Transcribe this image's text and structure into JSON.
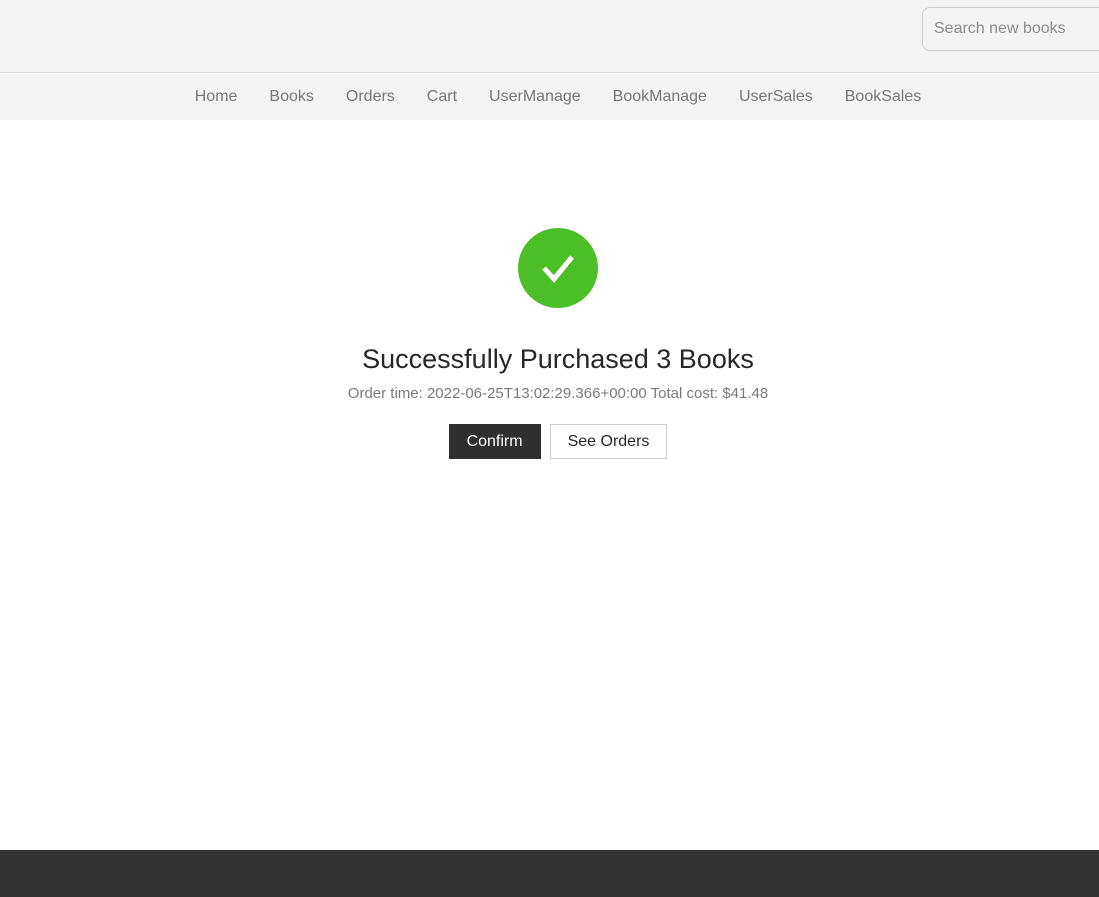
{
  "header": {
    "search": {
      "placeholder": "Search new books",
      "value": ""
    }
  },
  "nav": {
    "items": [
      {
        "label": "Home"
      },
      {
        "label": "Books"
      },
      {
        "label": "Orders"
      },
      {
        "label": "Cart"
      },
      {
        "label": "UserManage"
      },
      {
        "label": "BookManage"
      },
      {
        "label": "UserSales"
      },
      {
        "label": "BookSales"
      }
    ]
  },
  "result": {
    "status_icon": "check-circle-icon",
    "title": "Successfully Purchased 3 Books",
    "subtitle": "Order time: 2022-06-25T13:02:29.366+00:00 Total cost: $41.48",
    "confirm_label": "Confirm",
    "see_orders_label": "See Orders"
  },
  "colors": {
    "success": "#4cbf27",
    "primary_button": "#2f2f2f",
    "footer": "#333333",
    "header_bg": "#f4f4f4"
  }
}
